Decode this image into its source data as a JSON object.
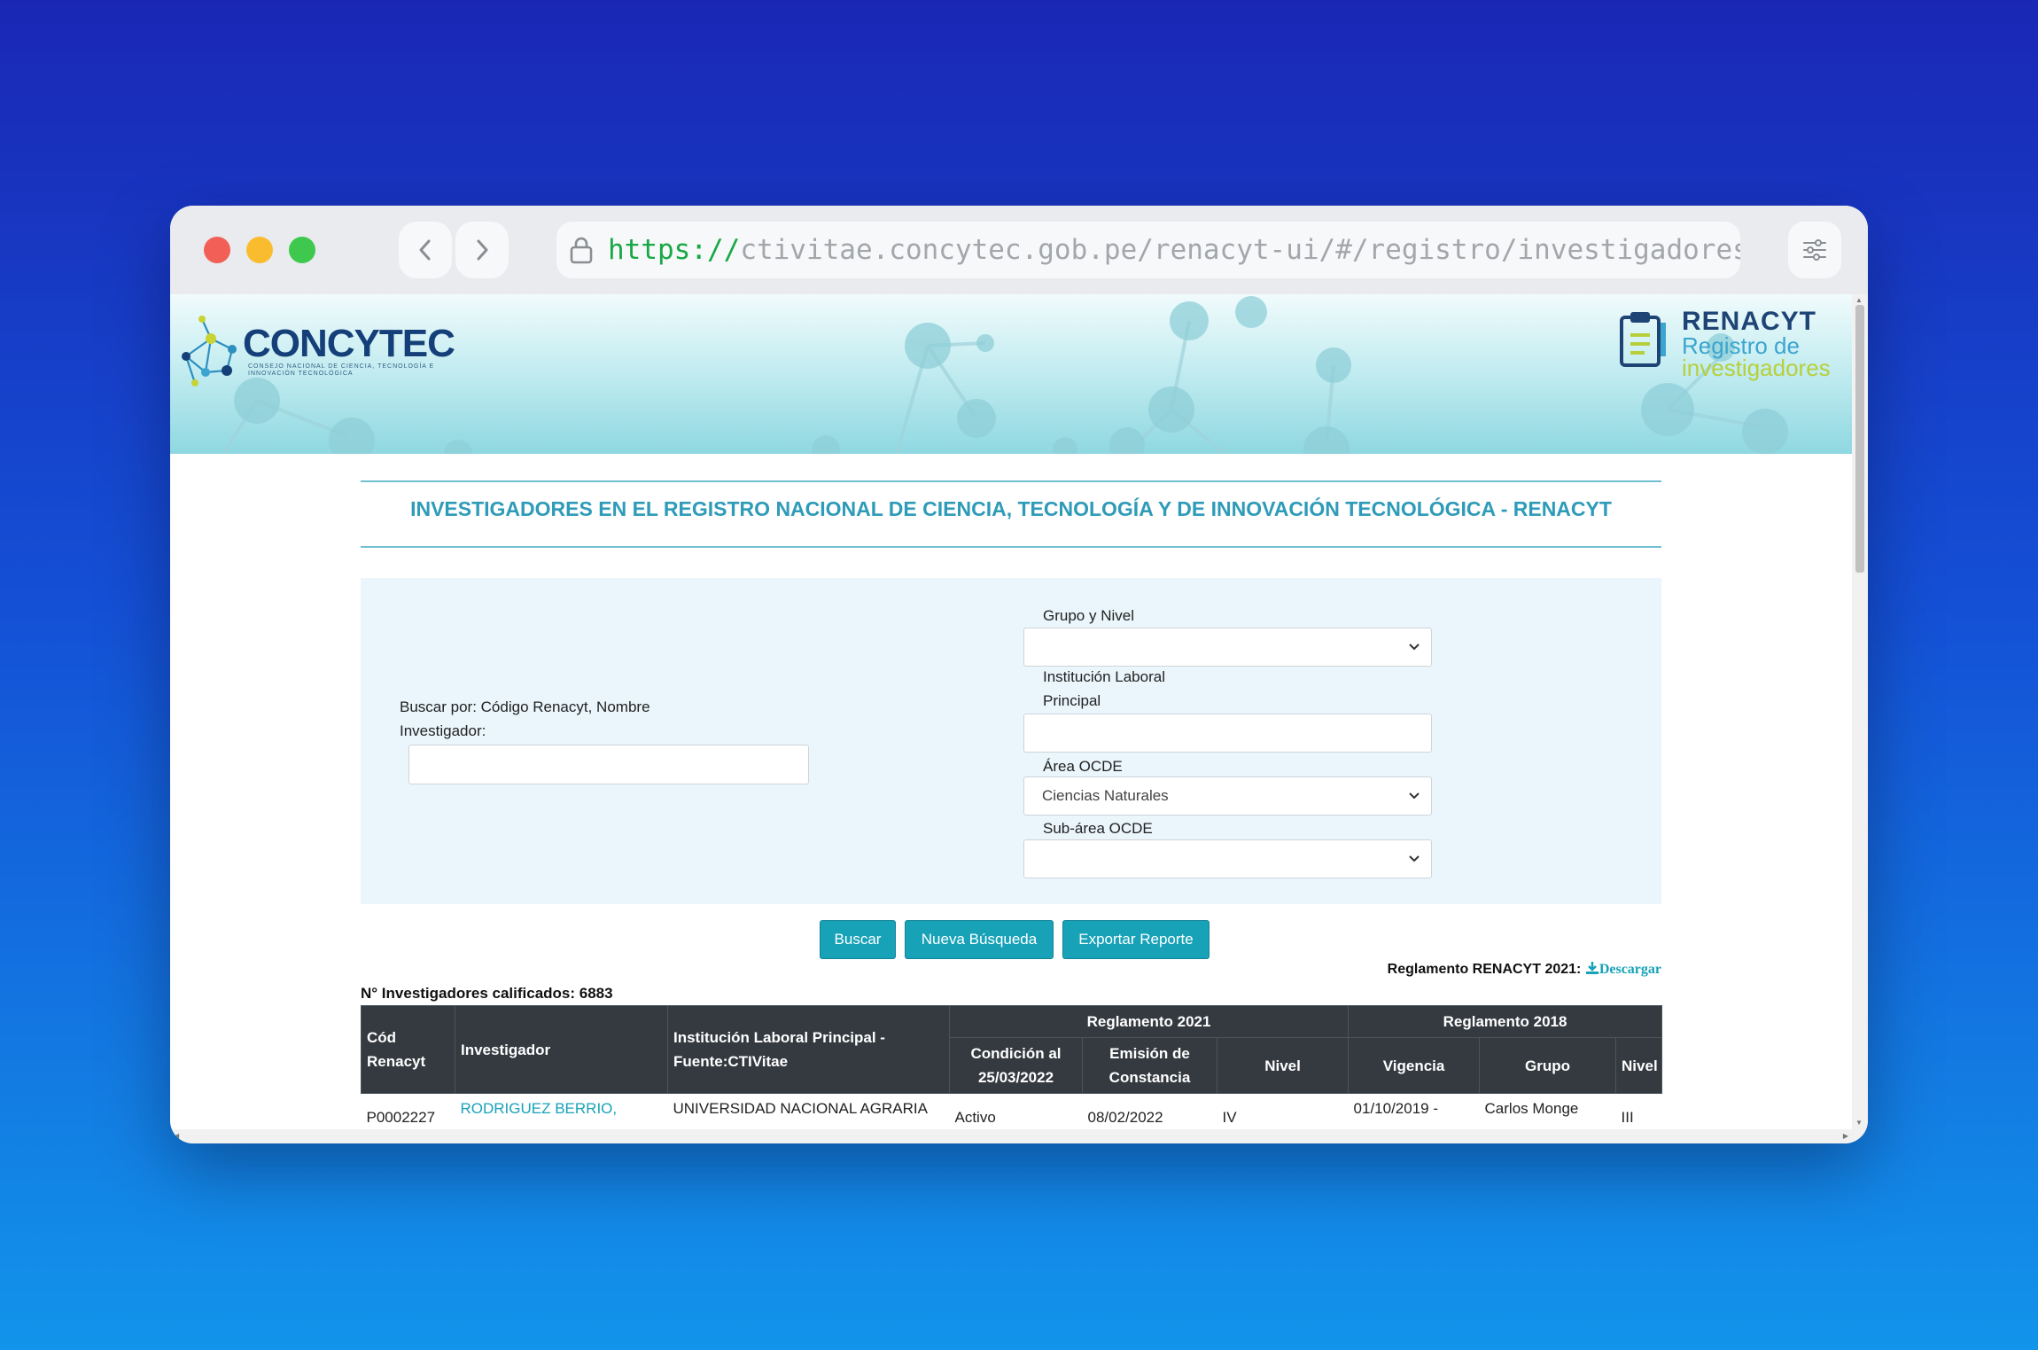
{
  "browser": {
    "url_scheme": "https://",
    "url_rest": "ctivitae.concytec.gob.pe/renacyt-ui/#/registro/investigadores"
  },
  "header": {
    "concytec_logo": "CONCYTEC",
    "concytec_sub": "CONSEJO NACIONAL DE CIENCIA, TECNOLOGÍA E INNOVACIÓN TECNOLÓGICA",
    "renacyt_title": "RENACYT",
    "renacyt_sub1": "Registro de",
    "renacyt_sub2": "investigadores"
  },
  "page": {
    "title": "INVESTIGADORES EN EL REGISTRO NACIONAL DE CIENCIA, TECNOLOGÍA Y DE INNOVACIÓN TECNOLÓGICA - RENACYT"
  },
  "search": {
    "buscar_label_1": "Buscar por: Código Renacyt, Nombre",
    "buscar_label_2": "Investigador:",
    "buscar_value": "",
    "grupo_label": "Grupo y Nivel",
    "grupo_value": "",
    "institucion_label_1": "Institución Laboral",
    "institucion_label_2": "Principal",
    "institucion_value": "",
    "area_label": "Área OCDE",
    "area_value": "Ciencias Naturales",
    "subarea_label": "Sub-área OCDE",
    "subarea_value": ""
  },
  "actions": {
    "buscar": "Buscar",
    "nueva": "Nueva Búsqueda",
    "exportar": "Exportar Reporte"
  },
  "reglamento": {
    "label": "Reglamento RENACYT 2021: ",
    "download": "Descargar"
  },
  "results": {
    "count_label": "N° Investigadores calificados: 6883",
    "headers": {
      "cod_1": "Cód",
      "cod_2": "Renacyt",
      "investigador": "Investigador",
      "institucion_1": "Institución Laboral Principal -",
      "institucion_2": "Fuente:CTIVitae",
      "reg2021": "Reglamento 2021",
      "reg2018": "Reglamento 2018",
      "condicion_1": "Condición al",
      "condicion_2": "25/03/2022",
      "emision_1": "Emisión de",
      "emision_2": "Constancia",
      "nivel": "Nivel",
      "vigencia": "Vigencia",
      "grupo": "Grupo",
      "nivel2018": "Nivel"
    },
    "rows": [
      {
        "cod": "P0002227",
        "investigador": "RODRIGUEZ BERRIO,",
        "institucion": "UNIVERSIDAD NACIONAL AGRARIA",
        "condicion": "Activo",
        "emision": "08/02/2022",
        "nivel": "IV",
        "vigencia": "01/10/2019 -",
        "grupo": "Carlos Monge",
        "nivel2018": "III"
      }
    ]
  }
}
